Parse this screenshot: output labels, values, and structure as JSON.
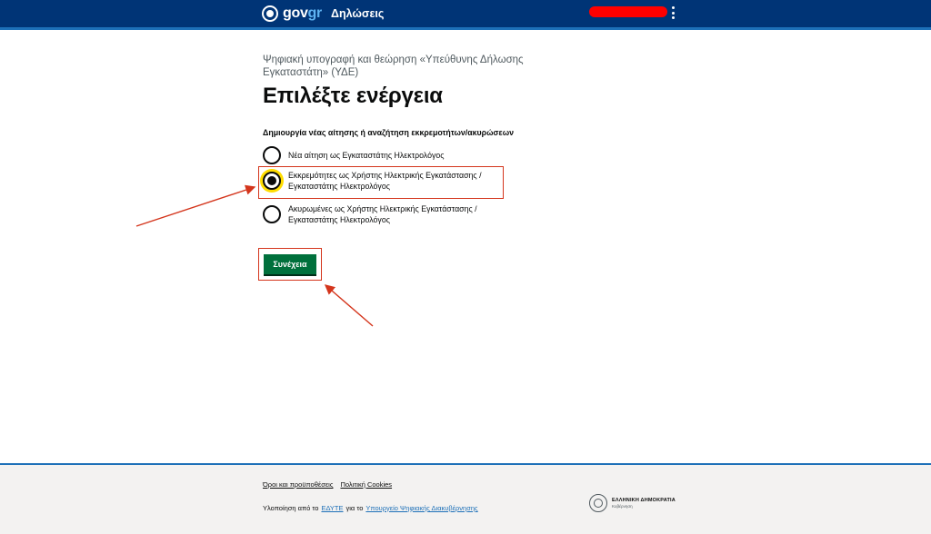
{
  "header": {
    "brand_gov": "gov",
    "brand_gr": "gr",
    "service_name": "Δηλώσεις",
    "menu_icon": "kebab-menu-icon",
    "brand_icon": "gov-emblem-icon"
  },
  "main": {
    "caption": "Ψηφιακή υπογραφή και θεώρηση «Υπεύθυνης Δήλωσης Εγκαταστάτη» (ΥΔΕ)",
    "title": "Επιλέξτε ενέργεια",
    "legend": "Δημιουργία νέας αίτησης ή αναζήτηση εκκρεμοτήτων/ακυρώσεων",
    "options": [
      {
        "label": "Νέα αίτηση ως Εγκαταστάτης Ηλεκτρολόγος",
        "checked": false
      },
      {
        "label": "Εκκρεμότητες ως Χρήστης Ηλεκτρικής Εγκατάστασης / Εγκαταστάτης Ηλεκτρολόγος",
        "checked": true
      },
      {
        "label": "Ακυρωμένες ως Χρήστης Ηλεκτρικής Εγκατάστασης / Εγκαταστάτης Ηλεκτρολόγος",
        "checked": false
      }
    ],
    "continue_label": "Συνέχεια"
  },
  "footer": {
    "terms_link": "Όροι και προϋποθέσεις",
    "cookies_link": "Πολιτική Cookies",
    "credit_prefix": "Υλοποίηση από το",
    "credit_org": "ΕΔΥΤΕ",
    "credit_middle": "για το",
    "credit_ministry": "Υπουργείο Ψηφιακής Διακυβέρνησης",
    "gov_logo_name": "ΕΛΛΗΝΙΚΗ ΔΗΜΟΚΡΑΤΙΑ",
    "gov_logo_sub": "Κυβέρνηση"
  },
  "colors": {
    "header_bg": "#003476",
    "accent_blue": "#1d70b8",
    "button_green": "#00703c",
    "annotation_red": "#d4351c",
    "focus_yellow": "#ffdd00"
  }
}
